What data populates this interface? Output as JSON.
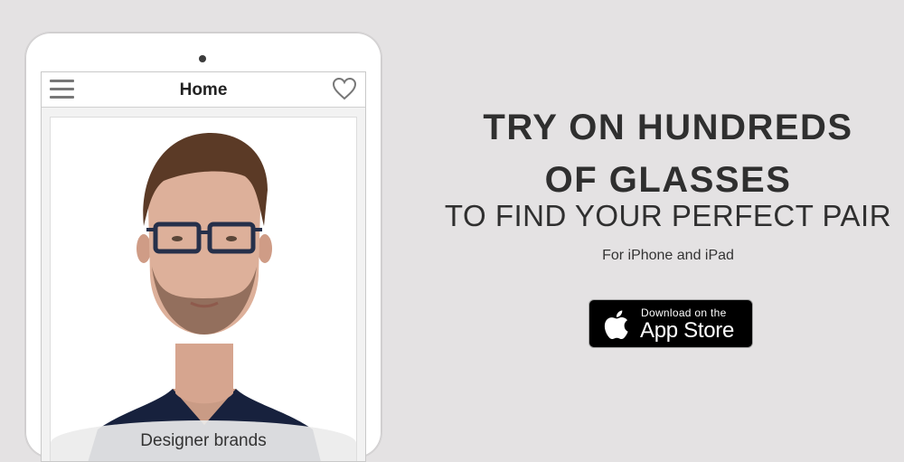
{
  "tablet_app": {
    "title": "Home",
    "card_caption": "Designer brands",
    "menu_icon": "hamburger-menu-icon",
    "favorite_icon": "heart-outline-icon"
  },
  "promo": {
    "headline_line1": "TRY ON HUNDREDS",
    "headline_line2": "OF GLASSES",
    "subheadline": "TO FIND YOUR PERFECT PAIR",
    "platform_text": "For iPhone and iPad"
  },
  "app_store_badge": {
    "small_text": "Download on the",
    "big_text": "App Store",
    "icon": "apple-logo-icon"
  },
  "colors": {
    "background": "#e4e2e3",
    "text": "#2f2f2f",
    "badge": "#000000"
  }
}
